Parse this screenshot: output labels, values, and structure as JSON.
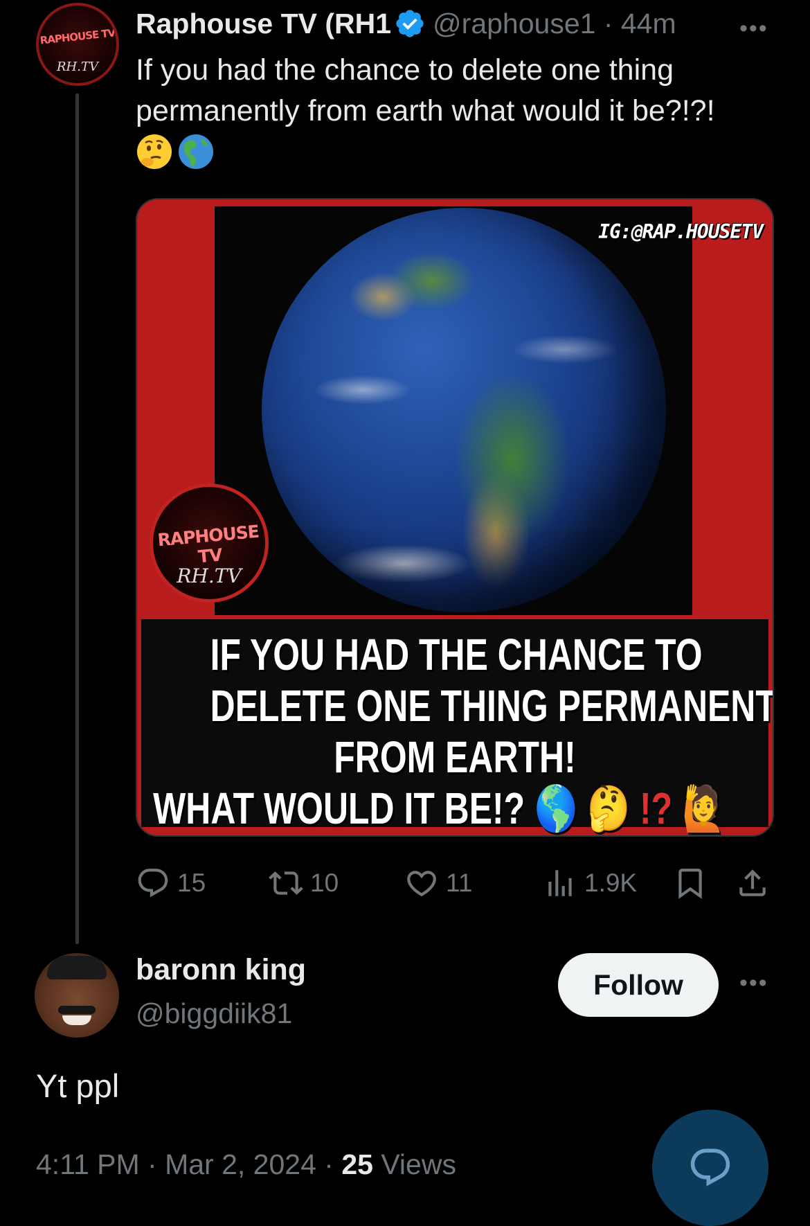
{
  "tweet": {
    "display_name": "Raphouse TV (RH1",
    "handle_meta": "@raphouse1 · 44m",
    "text": "If you had the chance to delete one thing permanently from earth what would it be?!?!",
    "emojis": [
      "thinking-face-emoji",
      "globe-americas-emoji"
    ],
    "media": {
      "ig_tag": "IG:@RAP.HOUSETV",
      "logo_text": "RAPHOUSE TV",
      "logo_sub": "RH.TV",
      "caption_lines": [
        "IF YOU HAD THE CHANCE TO",
        "DELETE ONE THING PERMANENTLY",
        "FROM EARTH!"
      ],
      "caption_last": "WHAT WOULD IT BE!?",
      "caption_suffix": "!?"
    },
    "actions": {
      "replies": "15",
      "reposts": "10",
      "likes": "11",
      "views": "1.9K"
    }
  },
  "avatar_text": {
    "main": "RAPHOUSE TV",
    "sub": "RH.TV"
  },
  "reply": {
    "name": "baronn king",
    "handle": "@biggdiik81",
    "follow_label": "Follow",
    "text": "Yt ppl",
    "timestamp": "4:11 PM · Mar 2, 2024 · ",
    "views_count": "25",
    "views_label": " Views"
  },
  "colors": {
    "background": "#000000",
    "primary_text": "#e7e9ea",
    "secondary_text": "#71767b",
    "verified_blue": "#1d9bf0",
    "media_red": "#b81c1c",
    "fab": "#0c3a5a"
  }
}
